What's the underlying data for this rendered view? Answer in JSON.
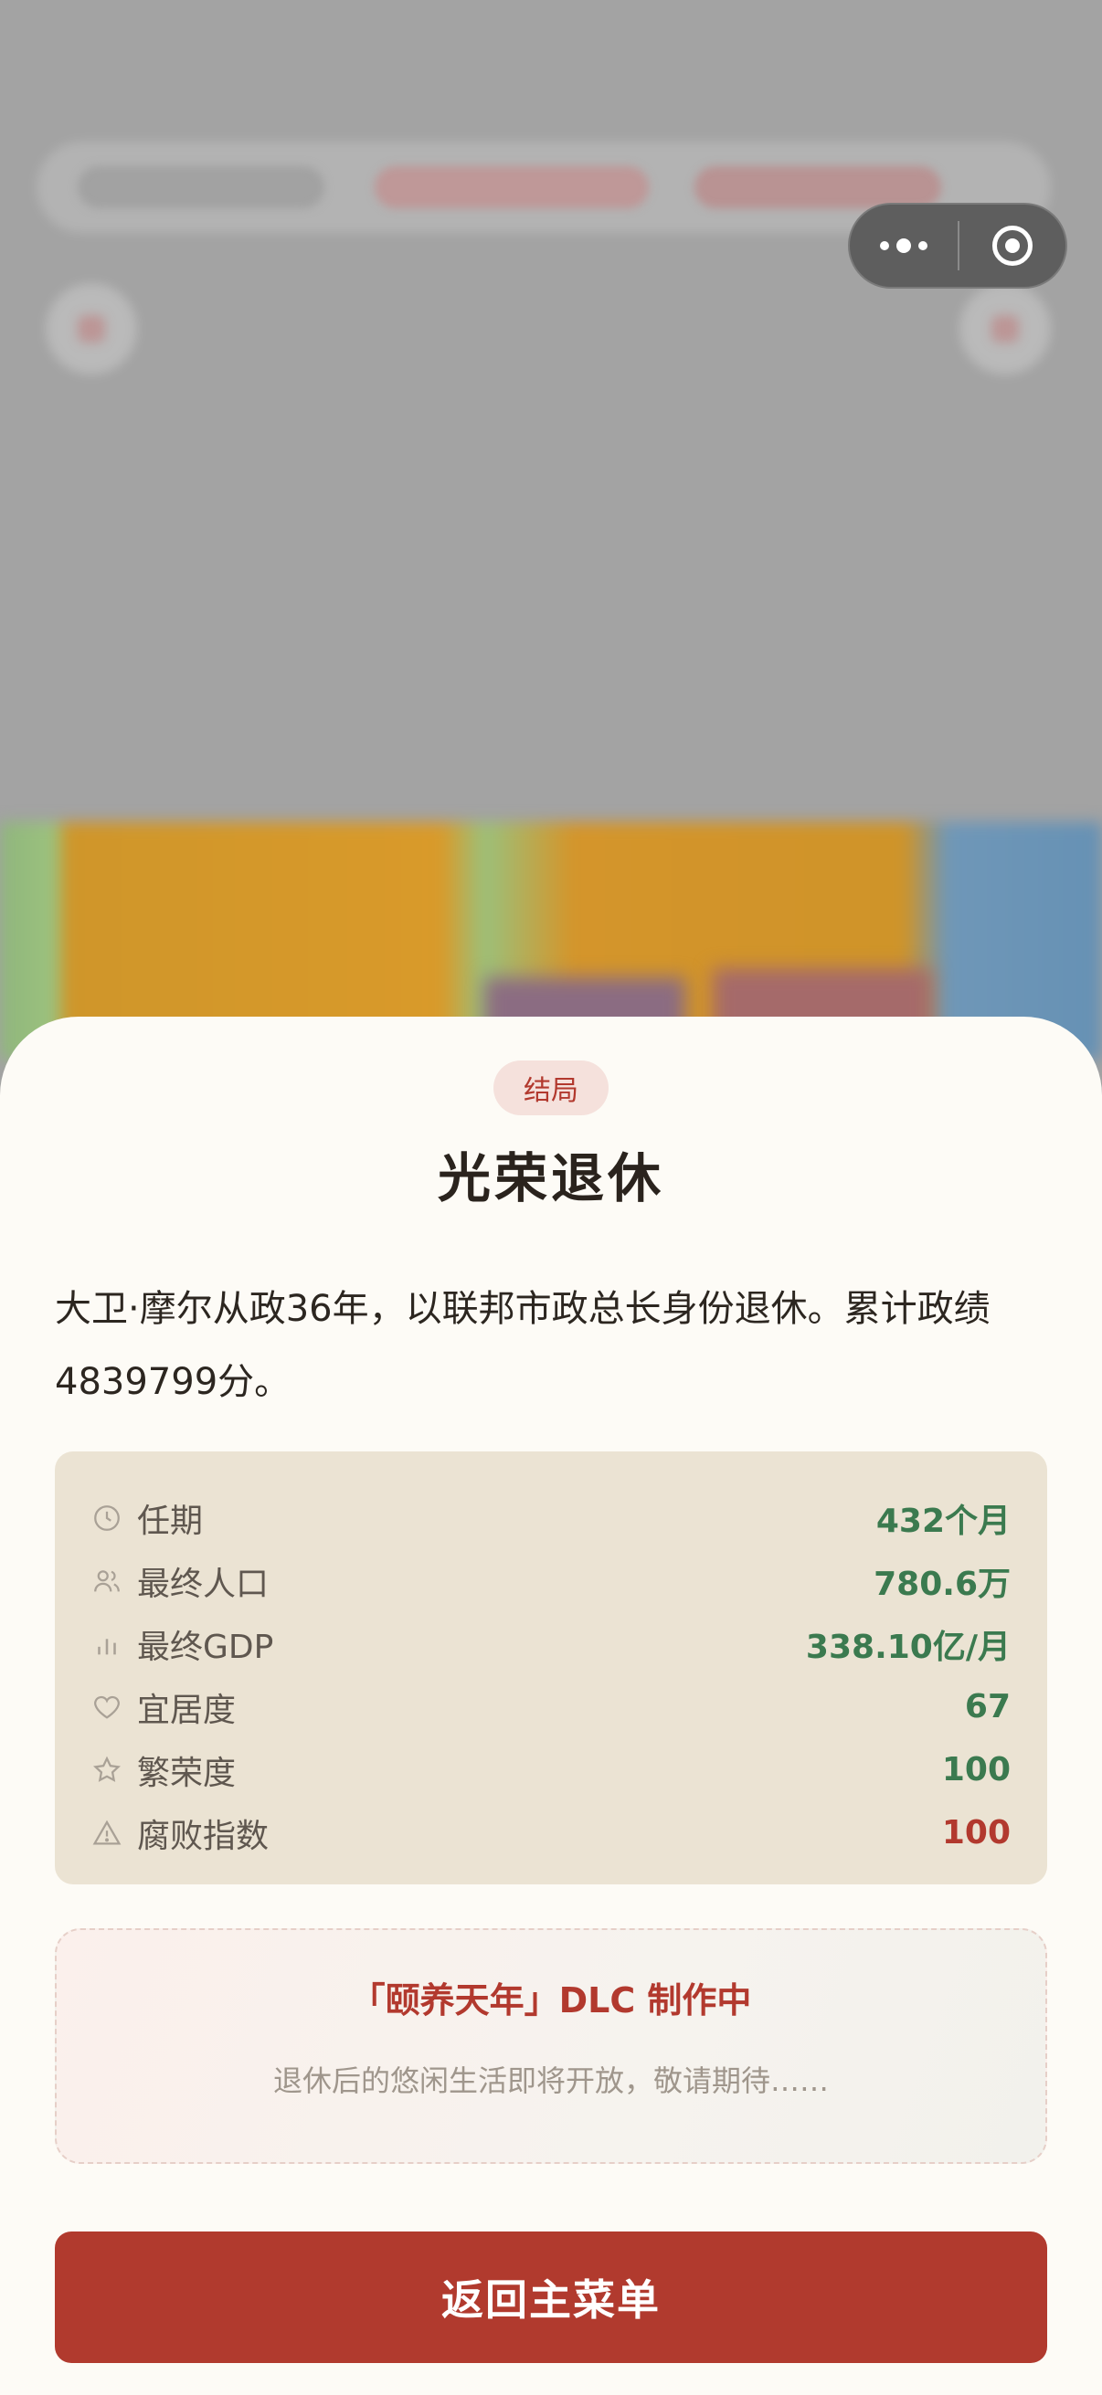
{
  "capsule": {
    "more_icon": "more-dots-icon",
    "close_icon": "target-close-icon"
  },
  "ending": {
    "badge": "结局",
    "title": "光荣退休",
    "description": "大卫·摩尔从政36年，以联邦市政总长身份退休。累计政绩4839799分。"
  },
  "stats": [
    {
      "icon": "clock-icon",
      "label": "任期",
      "value": "432个月",
      "tone": "good"
    },
    {
      "icon": "people-icon",
      "label": "最终人口",
      "value": "780.6万",
      "tone": "good"
    },
    {
      "icon": "bar-chart-icon",
      "label": "最终GDP",
      "value": "338.10亿/月",
      "tone": "good"
    },
    {
      "icon": "heart-icon",
      "label": "宜居度",
      "value": "67",
      "tone": "good"
    },
    {
      "icon": "star-icon",
      "label": "繁荣度",
      "value": "100",
      "tone": "good"
    },
    {
      "icon": "warning-icon",
      "label": "腐败指数",
      "value": "100",
      "tone": "bad"
    }
  ],
  "dlc": {
    "title": "「颐养天年」DLC 制作中",
    "subtitle": "退休后的悠闲生活即将开放，敬请期待……"
  },
  "buttons": {
    "back_to_menu": "返回主菜单"
  },
  "colors": {
    "accent": "#b13a2e",
    "good": "#3b7a4f",
    "panel": "#ebe3d3"
  }
}
